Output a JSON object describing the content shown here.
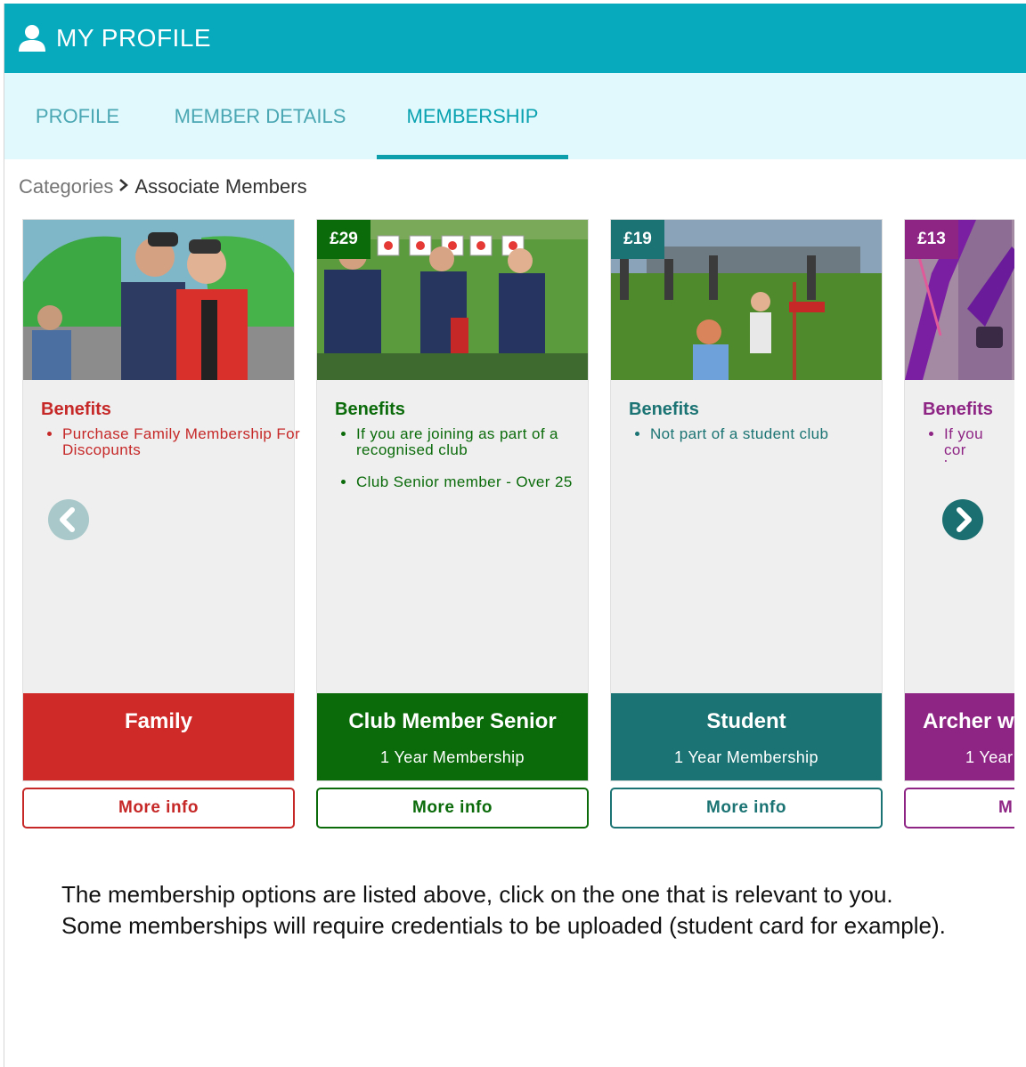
{
  "header": {
    "title": "MY PROFILE",
    "icon": "user-icon"
  },
  "tabs": [
    {
      "label": "PROFILE",
      "active": false
    },
    {
      "label": "MEMBER DETAILS",
      "active": false
    },
    {
      "label": "MEMBERSHIP",
      "active": true
    }
  ],
  "breadcrumb": {
    "root": "Categories",
    "current": "Associate Members"
  },
  "cards": [
    {
      "price": "",
      "benefits_title": "Benefits",
      "benefits": [
        "Purchase Family Membership For Discopunts"
      ],
      "name": "Family",
      "term": "",
      "more_label": "More info",
      "color": "#cf2a27"
    },
    {
      "price": "£29",
      "benefits_title": "Benefits",
      "benefits": [
        "If you are joining as part of a recognised club",
        "Club Senior member - Over 25"
      ],
      "name": "Club Member Senior",
      "term": "1 Year Membership",
      "more_label": "More info",
      "color": "#0b6b0b"
    },
    {
      "price": "£19",
      "benefits_title": "Benefits",
      "benefits": [
        "Not part of a student club"
      ],
      "name": "Student",
      "term": "1 Year Membership",
      "more_label": "More info",
      "color": "#1b7473"
    },
    {
      "price": "£13",
      "benefits_title": "Benefits",
      "benefits": [
        "If you cor have a di"
      ],
      "name": "Archer wi",
      "term": "1 Year",
      "more_label": "M",
      "color": "#8e2585"
    }
  ],
  "nav": {
    "prev_icon": "chevron-left-icon",
    "next_icon": "chevron-right-icon"
  },
  "info_text": "The membership options are listed above, click on the one that is relevant to you. Some memberships will require credentials to be uploaded (student card for example)."
}
